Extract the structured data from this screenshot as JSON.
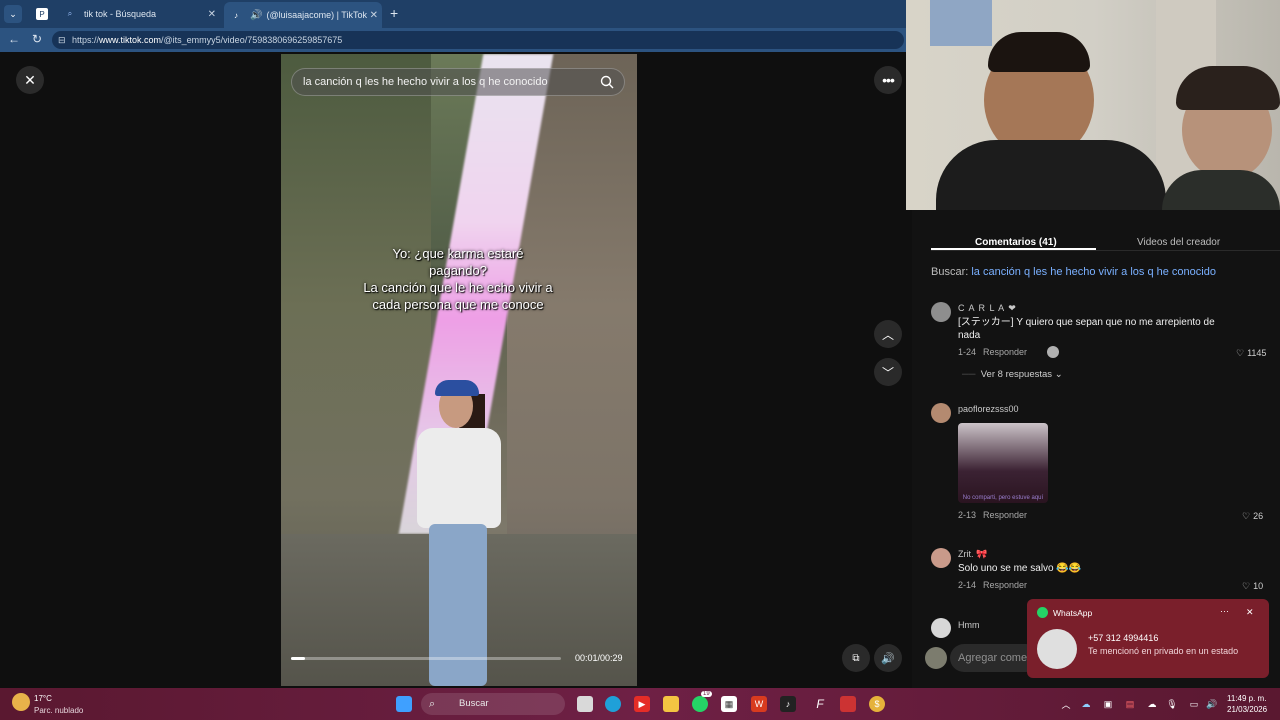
{
  "browser": {
    "tabs": [
      {
        "label": "",
        "icon": "pocket-icon"
      },
      {
        "label": "tik tok - Búsqueda",
        "icon": "search-icon"
      },
      {
        "label": "(@luisaajacome) | TikTok",
        "icon": "tiktok-icon"
      }
    ],
    "url_prefix": "https://",
    "url_domain": "www.tiktok.com",
    "url_path": "/@its_emmyy5/video/7598380696259857675"
  },
  "video": {
    "search_text": "la canción q les he hecho vivir a los q he conocido",
    "caption": "Yo: ¿que karma estaré pagando?\nLa canción que le he echo vivir a cada persona que me conoce",
    "time": "00:01/00:29",
    "progress": 0.05
  },
  "panel": {
    "tab_comments": "Comentarios (41)",
    "tab_creator": "Videos del creador",
    "search_label": "Buscar:",
    "search_query": "la canción q les he hecho vivir a los q he conocido",
    "comments": [
      {
        "user": "C A R L A ❤",
        "text": "[ステッカー] Y quiero que sepan que no me arrepiento de nada",
        "date": "1-24",
        "reply": "Responder",
        "likes": "1145"
      },
      {
        "user": "paoflorezsss00",
        "text": "",
        "date": "2-13",
        "reply": "Responder",
        "likes": "26",
        "sticker_caption": "No comparti, pero estuve aquí"
      },
      {
        "user": "Zrit. 🎀",
        "text": "Solo uno se me salvo 😂😂",
        "date": "2-14",
        "reply": "Responder",
        "likes": "10"
      },
      {
        "user": "Hmm",
        "text": "",
        "date": "",
        "reply": "",
        "likes": ""
      }
    ],
    "more_replies": "Ver 8 respuestas",
    "comment_placeholder": "Agregar come"
  },
  "toast": {
    "app": "WhatsApp",
    "title": "+57 312 4994416",
    "body": "Te mencionó en privado en un estado"
  },
  "taskbar": {
    "weather_temp": "17°C",
    "weather_desc": "Parc. nublado",
    "search": "Buscar",
    "time": "11:49 p. m.",
    "date": "21/03/2026",
    "whatsapp_badge": "19"
  },
  "colors": {
    "tab_bar": "#1f3f66",
    "panel_bg": "#121212",
    "link_blue": "#7ab0ff",
    "toast_bg": "#7a1f2b",
    "taskbar": "#6e2045"
  }
}
